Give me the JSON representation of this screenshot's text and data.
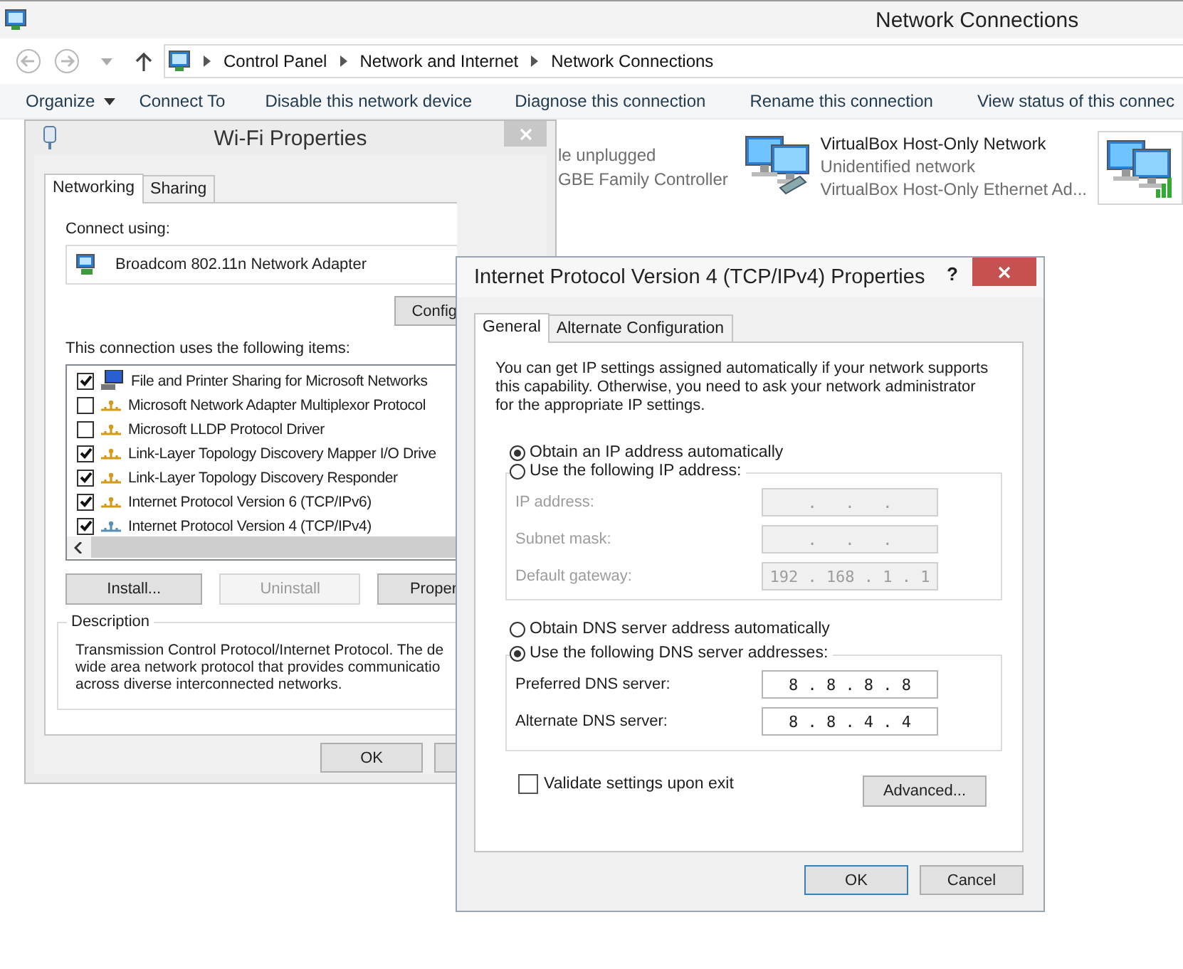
{
  "explorer": {
    "title": "Network Connections",
    "breadcrumb": [
      "Control Panel",
      "Network and Internet",
      "Network Connections"
    ],
    "toolbar": [
      {
        "label": "Organize",
        "menu": true
      },
      {
        "label": "Connect To",
        "menu": false
      },
      {
        "label": "Disable this network device",
        "menu": false
      },
      {
        "label": "Diagnose this connection",
        "menu": false
      },
      {
        "label": "Rename this connection",
        "menu": false
      },
      {
        "label": "View status of this connec",
        "menu": false
      }
    ],
    "connections": [
      {
        "kind": "wired",
        "status": "le unplugged",
        "device": "GBE Family Controller"
      },
      {
        "kind": "virtual",
        "name": "VirtualBox Host-Only Network",
        "status": "Unidentified network",
        "device": "VirtualBox Host-Only Ethernet Ad..."
      },
      {
        "kind": "wireless"
      }
    ]
  },
  "wifi": {
    "title": "Wi-Fi Properties",
    "tabs": [
      {
        "label": "Networking",
        "selected": true
      },
      {
        "label": "Sharing",
        "selected": false
      }
    ],
    "connect_using_label": "Connect using:",
    "adapter": "Broadcom 802.11n Network Adapter",
    "configure_button": "Config",
    "items_label": "This connection uses the following items:",
    "items": [
      {
        "label": "File and Printer Sharing for Microsoft Networks",
        "checked": true,
        "kind": "service"
      },
      {
        "label": "Microsoft Network Adapter Multiplexor Protocol",
        "checked": false,
        "kind": "protocol"
      },
      {
        "label": "Microsoft LLDP Protocol Driver",
        "checked": false,
        "kind": "protocol"
      },
      {
        "label": "Link-Layer Topology Discovery Mapper I/O Drive",
        "checked": true,
        "kind": "protocol"
      },
      {
        "label": "Link-Layer Topology Discovery Responder",
        "checked": true,
        "kind": "protocol"
      },
      {
        "label": "Internet Protocol Version 6 (TCP/IPv6)",
        "checked": true,
        "kind": "protocol"
      },
      {
        "label": "Internet Protocol Version 4 (TCP/IPv4)",
        "checked": true,
        "kind": "transport"
      }
    ],
    "buttons": [
      {
        "label": "Install...",
        "disabled": false
      },
      {
        "label": "Uninstall",
        "disabled": true
      },
      {
        "label": "Proper",
        "disabled": false
      }
    ],
    "description_label": "Description",
    "description_lines": [
      "Transmission Control Protocol/Internet Protocol. The de",
      "wide area network protocol that provides communicatio",
      "across diverse interconnected networks."
    ],
    "ok": "OK"
  },
  "ipv4": {
    "title": "Internet Protocol Version 4 (TCP/IPv4) Properties",
    "help": "?",
    "tabs": [
      {
        "label": "General",
        "selected": true
      },
      {
        "label": "Alternate Configuration",
        "selected": false
      }
    ],
    "intro": "You can get IP settings assigned automatically if your network supports this capability. Otherwise, you need to ask your network administrator for the appropriate IP settings.",
    "ip_options": [
      {
        "label": "Obtain an IP address automatically",
        "selected": true
      },
      {
        "label": "Use the following IP address:",
        "selected": false
      }
    ],
    "ip_fields": [
      {
        "label": "IP address:",
        "value": ".   .   .",
        "disabled": true
      },
      {
        "label": "Subnet mask:",
        "value": ".   .   .",
        "disabled": true
      },
      {
        "label": "Default gateway:",
        "value": "192 . 168 . 1 . 1",
        "disabled": true
      }
    ],
    "dns_options": [
      {
        "label": "Obtain DNS server address automatically",
        "selected": false
      },
      {
        "label": "Use the following DNS server addresses:",
        "selected": true
      }
    ],
    "dns_fields": [
      {
        "label": "Preferred DNS server:",
        "value": "8 . 8 . 8 . 8",
        "disabled": false
      },
      {
        "label": "Alternate DNS server:",
        "value": "8 . 8 . 4 . 4",
        "disabled": false
      }
    ],
    "validate": {
      "label": "Validate settings upon exit",
      "checked": false
    },
    "advanced": "Advanced...",
    "ok": "OK",
    "cancel": "Cancel"
  }
}
